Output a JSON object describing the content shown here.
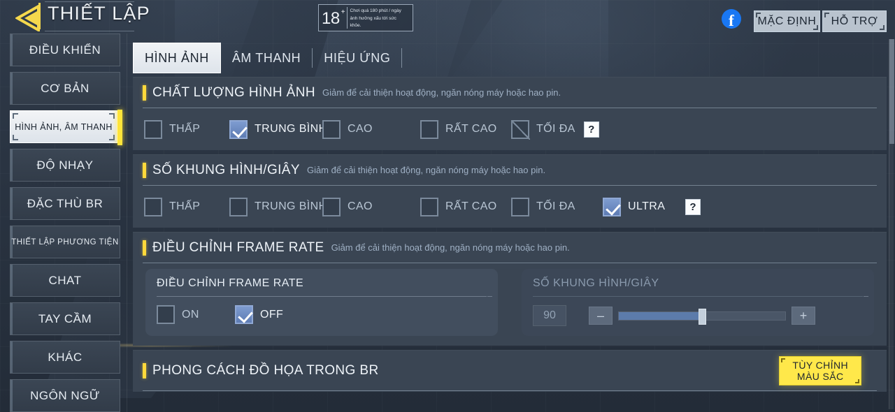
{
  "header": {
    "back_icon": "back-arrow-icon",
    "title": "THIẾT LẬP",
    "age_badge": {
      "number": "18",
      "plus": "+",
      "text": "Chơi quá 180 phút / ngày ảnh hưởng xấu tới sức khỏe."
    },
    "facebook_icon": "facebook-icon",
    "default_button": "MẶC ĐỊNH",
    "support_button": "HỖ TRỢ"
  },
  "sidebar": {
    "items": [
      {
        "label": "ĐIỀU KHIỂN",
        "active": false
      },
      {
        "label": "CƠ BẢN",
        "active": false
      },
      {
        "label": "HÌNH ẢNH, ÂM THANH",
        "active": true
      },
      {
        "label": "ĐỘ NHẠY",
        "active": false
      },
      {
        "label": "ĐẶC THÙ BR",
        "active": false
      },
      {
        "label": "THIẾT LẬP PHƯƠNG TIỆN",
        "active": false
      },
      {
        "label": "CHAT",
        "active": false
      },
      {
        "label": "TAY CẦM",
        "active": false
      },
      {
        "label": "KHÁC",
        "active": false
      },
      {
        "label": "NGÔN NGỮ",
        "active": false
      }
    ]
  },
  "tabs": [
    {
      "label": "HÌNH ẢNH",
      "active": true
    },
    {
      "label": "ÂM THANH",
      "active": false
    },
    {
      "label": "HIỆU ỨNG",
      "active": false
    }
  ],
  "sections": {
    "image_quality": {
      "title": "CHẤT LƯỢNG HÌNH ẢNH",
      "desc": "Giảm để cải thiện hoạt động, ngăn nóng máy hoặc hao pin.",
      "options": [
        {
          "label": "THẤP",
          "state": "unchecked"
        },
        {
          "label": "TRUNG BÌNH",
          "state": "checked"
        },
        {
          "label": "CAO",
          "state": "unchecked"
        },
        {
          "label": "RẤT CAO",
          "state": "unchecked"
        },
        {
          "label": "TỐI ĐA",
          "state": "disabled"
        }
      ],
      "help_label": "?"
    },
    "fps": {
      "title": "SỐ KHUNG HÌNH/GIÂY",
      "desc": "Giảm để cải thiện hoạt động, ngăn nóng máy hoặc hao pin.",
      "options": [
        {
          "label": "THẤP",
          "state": "unchecked"
        },
        {
          "label": "TRUNG BÌNH",
          "state": "unchecked"
        },
        {
          "label": "CAO",
          "state": "unchecked"
        },
        {
          "label": "RẤT CAO",
          "state": "unchecked"
        },
        {
          "label": "TỐI ĐA",
          "state": "unchecked"
        },
        {
          "label": "ULTRA",
          "state": "checked"
        }
      ],
      "help_label": "?"
    },
    "frame_rate": {
      "title": "ĐIỀU CHỈNH FRAME RATE",
      "desc": "Giảm để cải thiện hoạt động, ngăn nóng máy hoặc hao pin.",
      "toggle_panel": {
        "title": "ĐIỀU CHỈNH FRAME RATE",
        "options": [
          {
            "label": "ON",
            "state": "unchecked"
          },
          {
            "label": "OFF",
            "state": "checked"
          }
        ]
      },
      "slider_panel": {
        "title": "SỐ KHUNG HÌNH/GIÂY",
        "value": "90",
        "minus_label": "–",
        "plus_label": "+",
        "fill_percent": 50,
        "enabled": false
      }
    },
    "graphic_style": {
      "title": "PHONG CÁCH ĐỒ HỌA TRONG BR",
      "custom_color_button_line1": "TÙY CHỈNH",
      "custom_color_button_line2": "MÀU SẮC"
    }
  },
  "colors": {
    "accent_yellow": "#ffd93b",
    "checkbox_blue": "#6b88c0",
    "panel_bg": "#3a4553",
    "page_bg": "#2a3442"
  }
}
